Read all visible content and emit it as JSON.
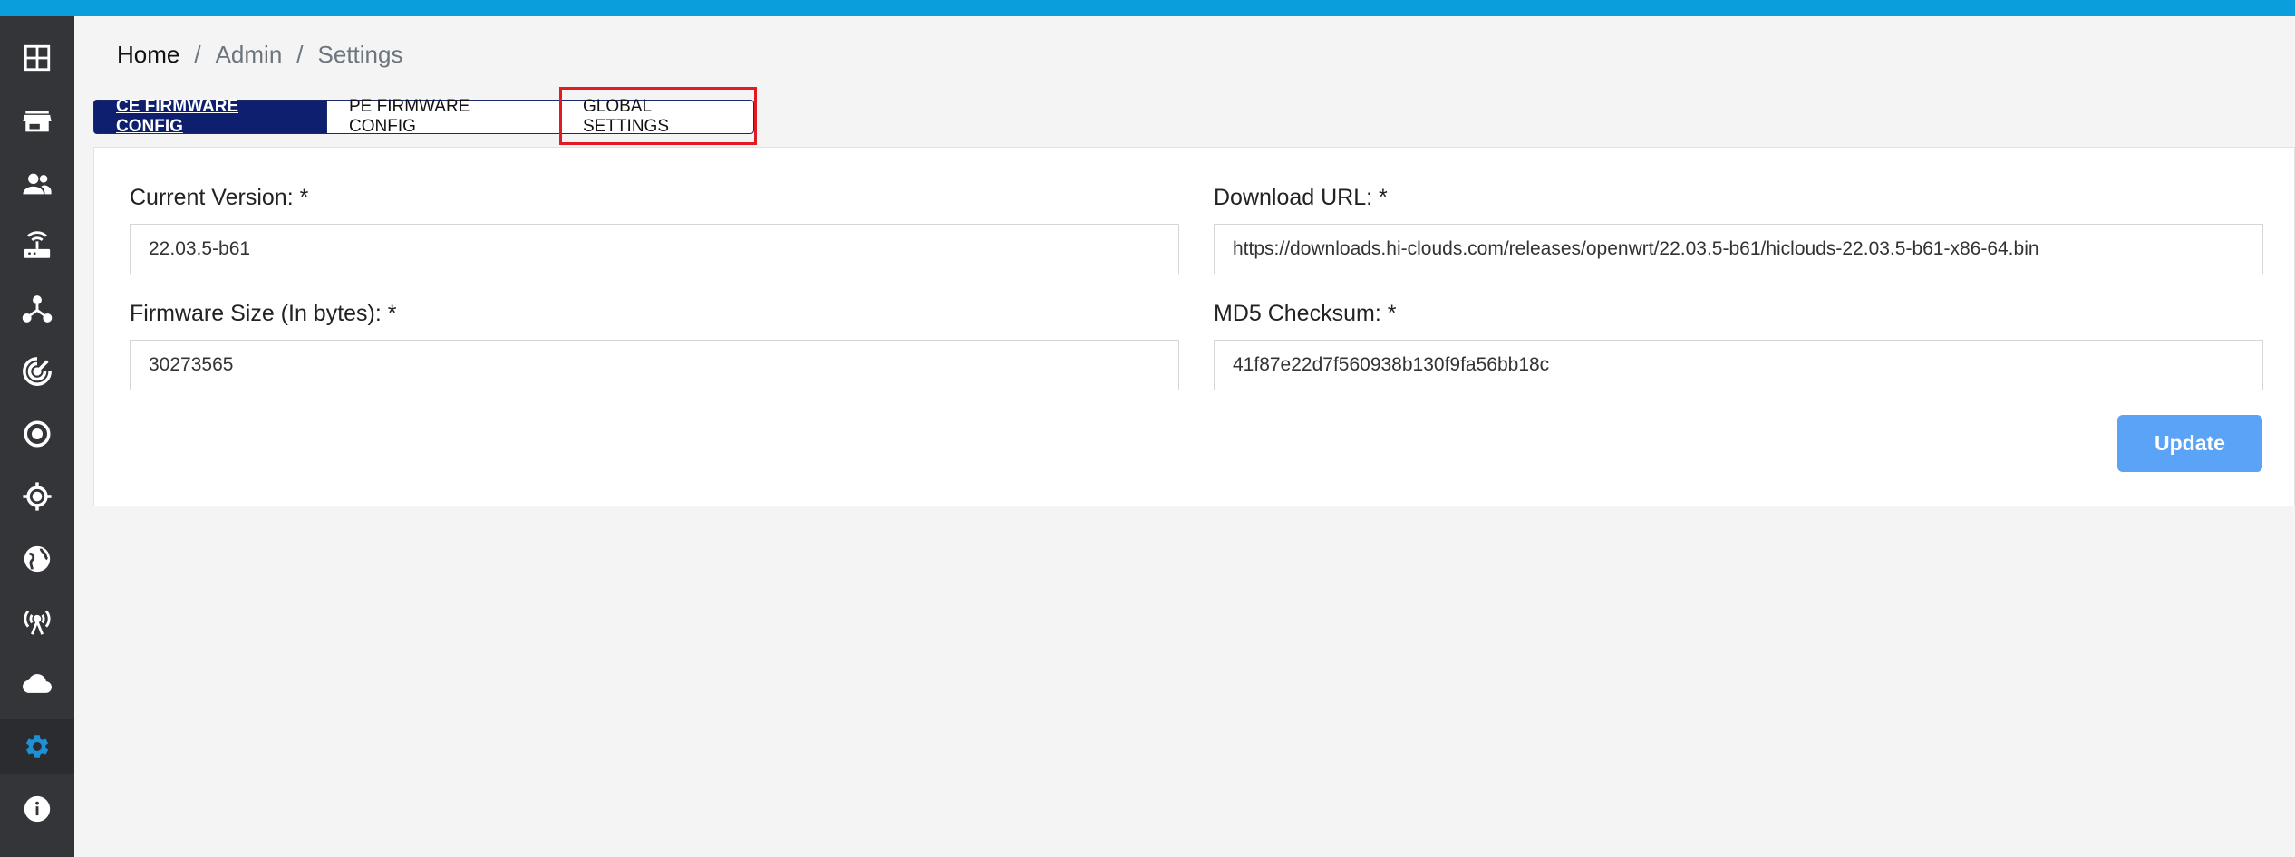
{
  "breadcrumb": {
    "items": [
      "Home",
      "Admin",
      "Settings"
    ],
    "separator": "/"
  },
  "tabs": [
    {
      "label": "CE FIRMWARE CONFIG",
      "active": true
    },
    {
      "label": "PE FIRMWARE CONFIG",
      "active": false
    },
    {
      "label": "GLOBAL SETTINGS",
      "active": false
    }
  ],
  "form": {
    "current_version": {
      "label": "Current Version: *",
      "value": "22.03.5-b61"
    },
    "download_url": {
      "label": "Download URL: *",
      "value": "https://downloads.hi-clouds.com/releases/openwrt/22.03.5-b61/hiclouds-22.03.5-b61-x86-64.bin"
    },
    "firmware_size": {
      "label": "Firmware Size (In bytes): *",
      "value": "30273565"
    },
    "md5_checksum": {
      "label": "MD5 Checksum: *",
      "value": "41f87e22d7f560938b130f9fa56bb18c"
    },
    "update_label": "Update"
  },
  "sidebar": {
    "items": [
      {
        "icon": "dashboard-icon"
      },
      {
        "icon": "store-icon"
      },
      {
        "icon": "users-icon"
      },
      {
        "icon": "router-icon"
      },
      {
        "icon": "network-icon"
      },
      {
        "icon": "radar-icon"
      },
      {
        "icon": "target-icon"
      },
      {
        "icon": "crosshair-icon"
      },
      {
        "icon": "globe-icon"
      },
      {
        "icon": "antenna-icon"
      },
      {
        "icon": "cloud-icon"
      },
      {
        "icon": "gear-icon",
        "active": true
      },
      {
        "icon": "info-icon"
      }
    ]
  },
  "colors": {
    "topbar": "#0a9fdc",
    "sidebar": "#333539",
    "active_tab": "#0d1f6e",
    "active_icon": "#1e90d6",
    "update_button": "#5ba3f7",
    "highlight": "#e21b23"
  }
}
